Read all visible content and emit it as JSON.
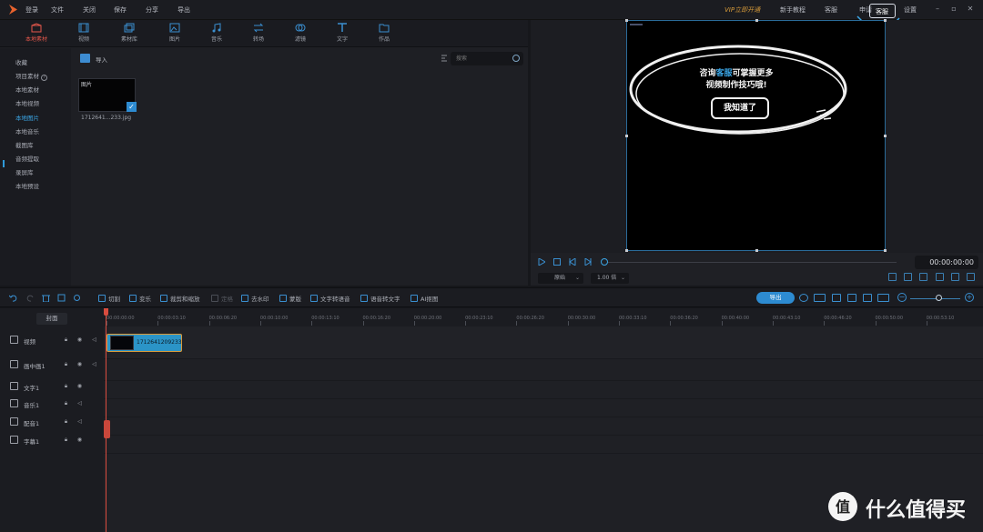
{
  "colors": {
    "accent": "#2d8bd1",
    "active_tab": "#e5574b",
    "vip": "#d69a3a",
    "playhead": "#d94c3f",
    "background": "#16171b"
  },
  "menu": {
    "login": "登录",
    "file": "文件",
    "close": "关闭",
    "save": "保存",
    "share": "分享",
    "export": "导出"
  },
  "top_right": {
    "vip": "VIP立即开通",
    "tutorial": "新手教程",
    "service": "客服",
    "apply": "申请",
    "kefu_highlight": "客服",
    "settings": "设置"
  },
  "media_tabs": [
    {
      "label": "本地素材",
      "icon": "box-icon"
    },
    {
      "label": "视频",
      "icon": "film-icon"
    },
    {
      "label": "素材库",
      "icon": "library-icon"
    },
    {
      "label": "图片",
      "icon": "image-icon"
    },
    {
      "label": "音乐",
      "icon": "music-icon"
    },
    {
      "label": "转场",
      "icon": "transition-icon"
    },
    {
      "label": "滤镜",
      "icon": "filter-icon"
    },
    {
      "label": "文字",
      "icon": "text-icon"
    },
    {
      "label": "作品",
      "icon": "folder-icon"
    }
  ],
  "categories": [
    "收藏",
    "项目素材",
    "本地素材",
    "本地视频",
    "本地图片",
    "本地音乐",
    "截图库",
    "音频提取",
    "录屏库",
    "本地预设"
  ],
  "browser": {
    "import": "导入",
    "search_placeholder": "搜索"
  },
  "media_card": {
    "type": "图片",
    "name": "1712641...233.jpg"
  },
  "preview": {
    "bubble_line1_pre": "咨询",
    "bubble_line1_hl": "客服",
    "bubble_line1_post": "可掌握更多",
    "bubble_line2": "视频制作技巧哦!",
    "button": "我知道了",
    "timecode": "00:00:00:00",
    "ratio": "原始",
    "speed": "1.00 倍"
  },
  "toolbar": {
    "cut": "切割",
    "speed": "变乐",
    "crop_zoom": "裁剪和缩放",
    "freeze": "定格",
    "mosaic": "去水印",
    "mask": "蒙版",
    "text_to_speech": "文字转语音",
    "speech_to_text": "语音转文字",
    "ai_subtitle": "AI抠图",
    "export": "导出"
  },
  "timeline": {
    "cover": "封面",
    "tracks": [
      "视频",
      "画中画1",
      "文字1",
      "音乐1",
      "配音1",
      "字幕1"
    ],
    "ticks": [
      "00:00:00:00",
      "00:00:03:10",
      "00:00:06:20",
      "00:00:10:00",
      "00:00:13:10",
      "00:00:16:20",
      "00:00:20:00",
      "00:00:23:10",
      "00:00:26:20",
      "00:00:30:00",
      "00:00:33:10",
      "00:00:36:20",
      "00:00:40:00",
      "00:00:43:10",
      "00:00:46:20",
      "00:00:50:00",
      "00:00:53:10"
    ],
    "clip_name": "1712641209233"
  },
  "watermark": {
    "text": "什么值得买"
  }
}
